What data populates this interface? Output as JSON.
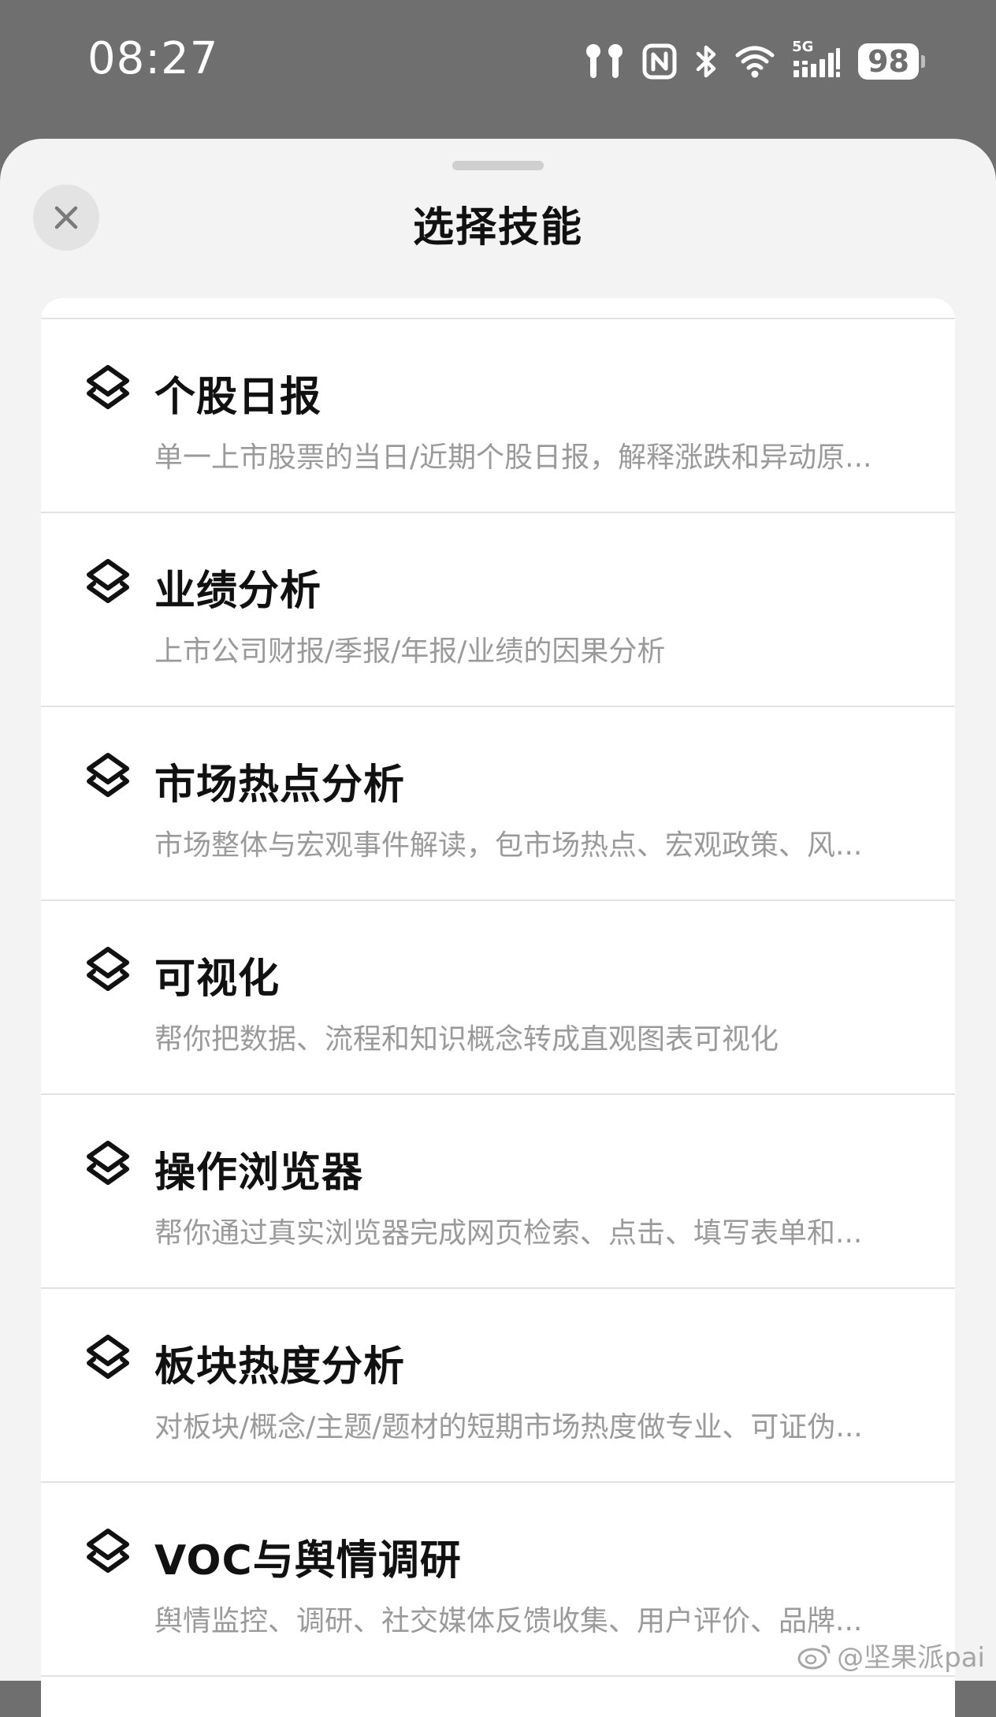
{
  "status_bar": {
    "time": "08:27",
    "network": "5G",
    "battery": "98",
    "icons": [
      "earbuds-icon",
      "nfc-icon",
      "bluetooth-icon",
      "wifi-icon",
      "cellular-signal-icon",
      "battery-icon"
    ]
  },
  "sheet": {
    "title": "选择技能",
    "close_icon": "close-icon"
  },
  "skills": [
    {
      "name": "个股日报",
      "description": "单一上市股票的当日/近期个股日报，解释涨跌和异动原...",
      "icon": "layers-icon"
    },
    {
      "name": "业绩分析",
      "description": "上市公司财报/季报/年报/业绩的因果分析",
      "icon": "layers-icon"
    },
    {
      "name": "市场热点分析",
      "description": "市场整体与宏观事件解读，包市场热点、宏观政策、风...",
      "icon": "layers-icon"
    },
    {
      "name": "可视化",
      "description": "帮你把数据、流程和知识概念转成直观图表可视化",
      "icon": "layers-icon"
    },
    {
      "name": "操作浏览器",
      "description": "帮你通过真实浏览器完成网页检索、点击、填写表单和...",
      "icon": "layers-icon"
    },
    {
      "name": "板块热度分析",
      "description": "对板块/概念/主题/题材的短期市场热度做专业、可证伪...",
      "icon": "layers-icon"
    },
    {
      "name": "VOC与舆情调研",
      "description": "舆情监控、调研、社交媒体反馈收集、用户评价、品牌...",
      "icon": "layers-icon"
    }
  ],
  "watermark": {
    "text": "@坚果派pai",
    "icon": "weibo-icon"
  }
}
